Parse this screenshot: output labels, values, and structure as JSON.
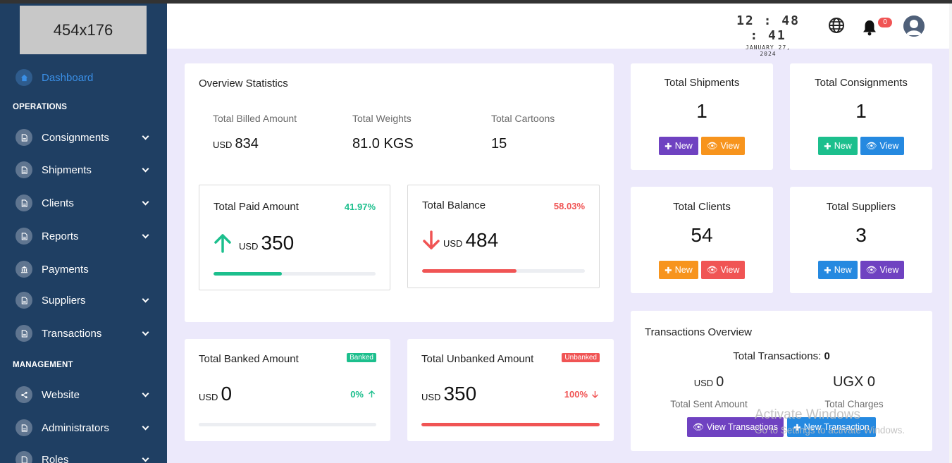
{
  "logo": {
    "text": "454x176"
  },
  "sidebar": {
    "dashboard": "Dashboard",
    "section_operations": "OPERATIONS",
    "section_management": "MANAGEMENT",
    "items": [
      {
        "label": "Consignments"
      },
      {
        "label": "Shipments"
      },
      {
        "label": "Clients"
      },
      {
        "label": "Reports"
      },
      {
        "label": "Payments"
      },
      {
        "label": "Suppliers"
      },
      {
        "label": "Transactions"
      }
    ],
    "mgmt_items": [
      {
        "label": "Website"
      },
      {
        "label": "Administrators"
      },
      {
        "label": "Roles"
      }
    ]
  },
  "header": {
    "time": "12 : 48 : 41",
    "date": "JANUARY 27, 2024",
    "notifications": "0"
  },
  "overview": {
    "title": "Overview Statistics",
    "billed_label": "Total Billed Amount",
    "billed_currency": "USD",
    "billed_value": "834",
    "weights_label": "Total Weights",
    "weights_value": "81.0 KGS",
    "cartoons_label": "Total Cartoons",
    "cartoons_value": "15",
    "paid": {
      "label": "Total Paid Amount",
      "percent": "41.97%",
      "currency": "USD",
      "value": "350",
      "fill": 0.4197
    },
    "balance": {
      "label": "Total Balance",
      "percent": "58.03%",
      "currency": "USD",
      "value": "484",
      "fill": 0.5803
    }
  },
  "banked": {
    "label": "Total Banked Amount",
    "tag": "Banked",
    "currency": "USD",
    "value": "0",
    "percent": "0%",
    "fill": 0
  },
  "unbanked": {
    "label": "Total Unbanked Amount",
    "tag": "Unbanked",
    "currency": "USD",
    "value": "350",
    "percent": "100%",
    "fill": 1.0
  },
  "cards": {
    "shipments": {
      "title": "Total Shipments",
      "count": "1",
      "new": "New",
      "view": "View"
    },
    "consignments": {
      "title": "Total Consignments",
      "count": "1",
      "new": "New",
      "view": "View"
    },
    "clients": {
      "title": "Total Clients",
      "count": "54",
      "new": "New",
      "view": "View"
    },
    "suppliers": {
      "title": "Total Suppliers",
      "count": "3",
      "new": "New",
      "view": "View"
    }
  },
  "transactions": {
    "title": "Transactions Overview",
    "total_label": "Total Transactions:",
    "total_value": "0",
    "sent_currency": "USD",
    "sent_value": "0",
    "sent_label": "Total Sent Amount",
    "charges_value": "UGX 0",
    "charges_label": "Total Charges",
    "view_button": "View Transactions",
    "new_button": "New Transaction"
  },
  "watermark": {
    "line1": "Activate Windows",
    "line2": "Go to Settings to activate Windows."
  },
  "colors": {
    "sidebar": "#1f3f63",
    "accent_green": "#1cbf8d",
    "accent_red": "#f05454",
    "purple": "#6f42c1",
    "orange": "#f7941d",
    "blue": "#2589e0",
    "background": "#ece9fb"
  }
}
